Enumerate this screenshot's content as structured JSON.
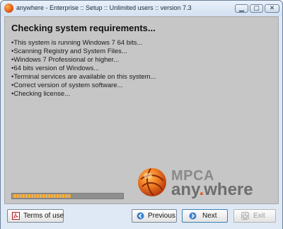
{
  "window": {
    "title": "anywhere - Enterprise :: Setup :: Unlimited users :: version 7.3",
    "minimize_glyph": "▁",
    "maximize_glyph": "▢",
    "close_glyph": "✕"
  },
  "main": {
    "heading": "Checking system requirements...",
    "checks": [
      "This system is running Windows 7 64 bits...",
      "Scanning Registry and System Files...",
      "Windows 7 Professional or higher...",
      "64 bits version of Windows...",
      "Terminal services are available on this system...",
      "Correct version of system software...",
      "Checking license..."
    ],
    "progress_percent": 53
  },
  "logo": {
    "line1": "MPCA",
    "any": "any",
    "dot": ".",
    "where": "where"
  },
  "footer": {
    "terms_label": "Terms of use",
    "previous_label": "Previous",
    "next_label": "Next",
    "exit_label": "Exit"
  },
  "icons": {
    "app": "app-logo-icon",
    "terms": "pdf-icon",
    "previous": "arrow-left-icon",
    "next": "arrow-right-icon",
    "exit": "exit-icon"
  },
  "colors": {
    "accent": "#e2571a",
    "progress": "#f0a020",
    "content_bg": "#c6c6c6",
    "frame_bg": "#dfe9f5"
  }
}
